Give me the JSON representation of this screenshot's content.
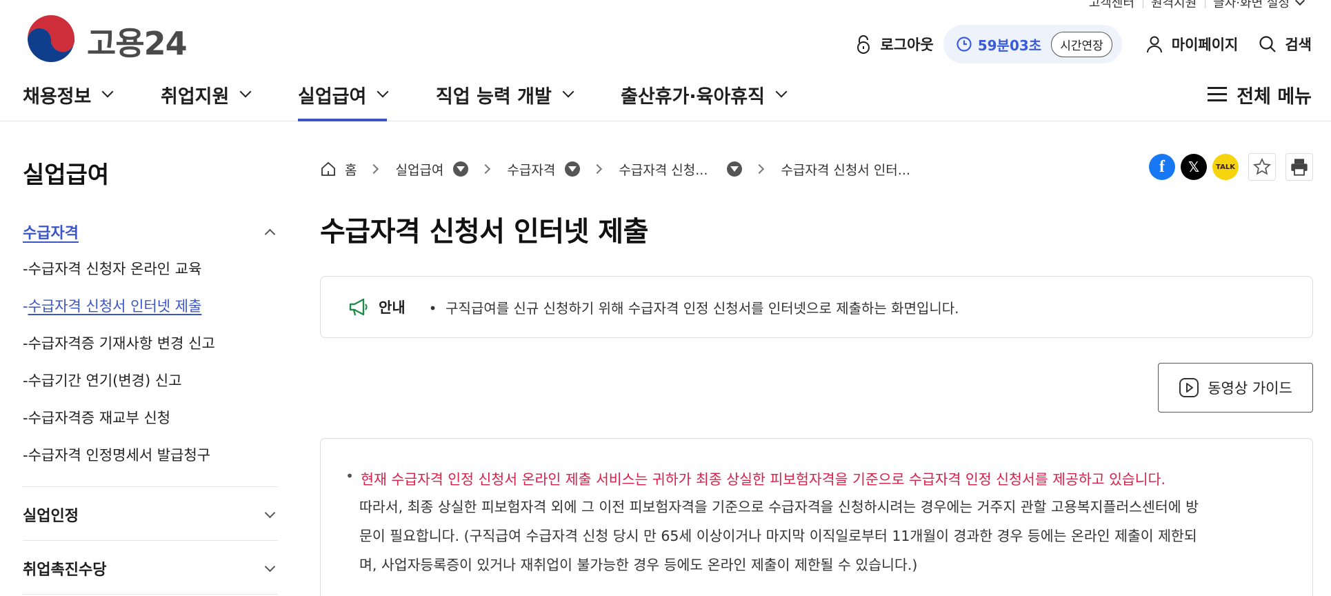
{
  "utility": {
    "customer_center": "고객센터",
    "remote_support": "원격지원",
    "font_screen": "글자·화면 설정"
  },
  "header": {
    "logo_text": "고용24",
    "logout": "로그아웃",
    "timer": "59분03초",
    "extend": "시간연장",
    "mypage": "마이페이지",
    "search": "검색"
  },
  "gnb": {
    "items": [
      "채용정보",
      "취업지원",
      "실업급여",
      "직업 능력 개발",
      "출산휴가·육아휴직"
    ],
    "all_menu": "전체 메뉴"
  },
  "sidebar": {
    "title": "실업급여",
    "section1": {
      "label": "수급자격",
      "items": [
        "수급자격 신청자 온라인 교육",
        "수급자격 신청서 인터넷 제출",
        "수급자격증 기재사항 변경 신고",
        "수급기간 연기(변경) 신고",
        "수급자격증 재교부 신청",
        "수급자격 인정명세서 발급청구"
      ]
    },
    "section2": {
      "label": "실업인정"
    },
    "section3": {
      "label": "취업촉진수당"
    }
  },
  "breadcrumb": [
    "홈",
    "실업급여",
    "수급자격",
    "수급자격 신청...",
    "수급자격 신청서 인터..."
  ],
  "page_title": "수급자격 신청서 인터넷 제출",
  "notice": {
    "label": "안내",
    "text": "구직급여를 신규 신청하기 위해 수급자격 인정 신청서를 인터넷으로 제출하는 화면입니다."
  },
  "video_guide": "동영상 가이드",
  "info": {
    "highlight": "현재 수급자격 인정 신청서 온라인 제출 서비스는 귀하가 최종 상실한 피보험자격을 기준으로 수급자격 인정 신청서를 제공하고 있습니다.",
    "line1": "따라서, 최종 상실한 피보험자격 외에 그 이전 피보험자격을 기준으로 수급자격을 신청하시려는 경우에는 거주지 관할 고용복지플러스센터에 방",
    "line2": "문이 필요합니다. (구직급여 수급자격 신청 당시 만 65세 이상이거나 마지막 이직일로부터 11개월이 경과한 경우 등에는 온라인 제출이 제한되",
    "line3": "며, 사업자등록증이 있거나 재취업이 불가능한 경우 등에도 온라인 제출이 제한될 수 있습니다.)"
  },
  "share": {
    "kakao_label": "TALK"
  },
  "colors": {
    "accent": "#3a55c8",
    "timer": "#3a5bd9",
    "highlight_red": "#d6204a"
  }
}
